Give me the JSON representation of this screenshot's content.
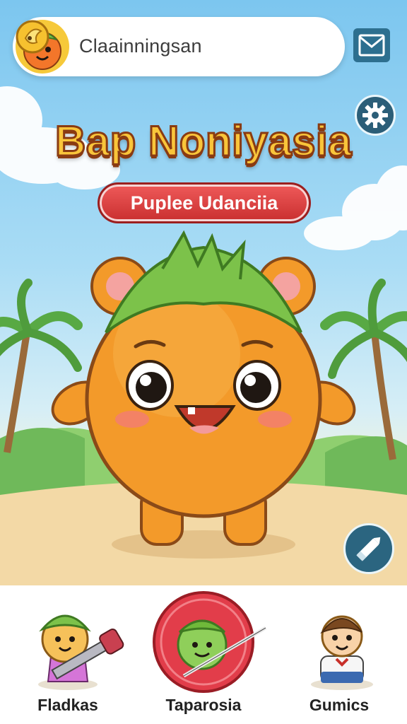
{
  "header": {
    "account_name": "Claainningsan",
    "title": "Bap Noniyasia",
    "subtitle": "Puplee Udanciia"
  },
  "icons": {
    "avatar": "orange-character-avatar",
    "currency": "gold-coin-icon",
    "mail": "mail-icon",
    "settings": "gear-icon",
    "edit": "pencil-edit-icon"
  },
  "bottom_nav": {
    "items": [
      {
        "label": "Fladkas",
        "icon": "character-with-sword-icon"
      },
      {
        "label": "Taparosia",
        "icon": "green-character-red-circle-icon",
        "active": true
      },
      {
        "label": "Gumics",
        "icon": "boy-character-icon"
      }
    ]
  },
  "colors": {
    "sky": "#7cc6ef",
    "title_fill": "#f9c53a",
    "title_outline": "#8a3b12",
    "badge": "#d93f3f",
    "accent_button": "#2b6580",
    "mascot": "#f39a2a"
  }
}
